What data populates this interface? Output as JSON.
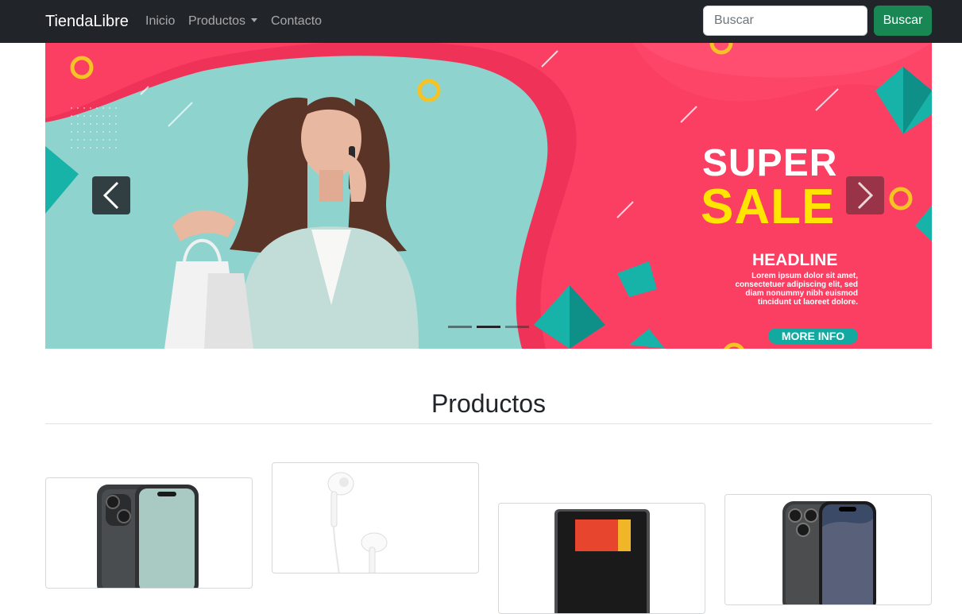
{
  "navbar": {
    "brand": "TiendaLibre",
    "links": [
      {
        "label": "Inicio"
      },
      {
        "label": "Productos",
        "has_dropdown": true
      },
      {
        "label": "Contacto"
      }
    ],
    "search": {
      "placeholder": "Buscar",
      "value": ""
    },
    "search_button": "Buscar"
  },
  "carousel": {
    "slide": {
      "line1": "SUPER",
      "line2": "SALE",
      "headline": "HEADLINE",
      "body": "Lorem ipsum dolor sit amet, consectetuer adipiscing elit, sed diam nonummy nibh euismod tincidunt ut laoreet dolore.",
      "cta": "MORE INFO"
    },
    "indicators": 3,
    "active_indicator": 2,
    "prev_icon": "chevron-left-icon",
    "next_icon": "chevron-right-icon"
  },
  "products": {
    "title": "Productos",
    "cards": [
      {
        "image": "smartphone-image"
      },
      {
        "image": "earphones-image"
      },
      {
        "image": "tablet-image"
      },
      {
        "image": "smartphone-pro-image"
      }
    ]
  },
  "colors": {
    "navbar_bg": "#212529",
    "accent_green": "#198754",
    "banner_pink": "#fb3f63",
    "banner_teal": "#8fd3cf",
    "sale_yellow": "#ffe500"
  }
}
